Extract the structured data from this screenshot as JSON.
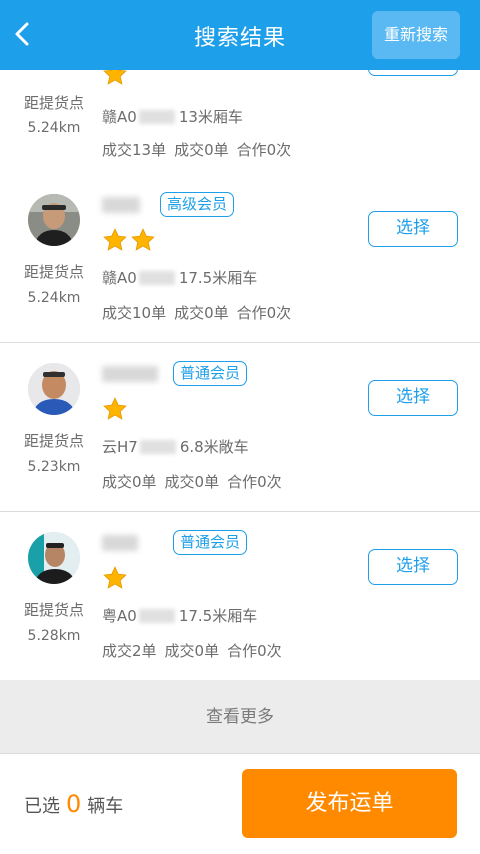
{
  "header": {
    "title": "搜索结果",
    "research_label": "重新搜索"
  },
  "colors": {
    "primary": "#1e9fe9",
    "accent": "#ff8a00",
    "star": "#ffb400"
  },
  "icons": {
    "back": "chevron-left-icon",
    "star": "star-icon"
  },
  "cards": [
    {
      "badge": "",
      "stars": 1,
      "distance_label": "距提货点",
      "distance": "5.24km",
      "vehicle_prefix": "赣A0",
      "vehicle_desc": "13米厢车",
      "stats": [
        "成交13单",
        "成交0单",
        "合作0次"
      ],
      "select_label": ""
    },
    {
      "badge": "高级会员",
      "stars": 2,
      "distance_label": "距提货点",
      "distance": "5.24km",
      "vehicle_prefix": "赣A0",
      "vehicle_desc": "17.5米厢车",
      "stats": [
        "成交10单",
        "成交0单",
        "合作0次"
      ],
      "select_label": "选择"
    },
    {
      "badge": "普通会员",
      "stars": 1,
      "distance_label": "距提货点",
      "distance": "5.23km",
      "vehicle_prefix": "云H7",
      "vehicle_desc": "6.8米敞车",
      "stats": [
        "成交0单",
        "成交0单",
        "合作0次"
      ],
      "select_label": "选择"
    },
    {
      "badge": "普通会员",
      "stars": 1,
      "distance_label": "距提货点",
      "distance": "5.28km",
      "vehicle_prefix": "粤A0",
      "vehicle_desc": "17.5米厢车",
      "stats": [
        "成交2单",
        "成交0单",
        "合作0次"
      ],
      "select_label": "选择"
    }
  ],
  "more_label": "查看更多",
  "footer": {
    "selected_prefix": "已选",
    "selected_count": "0",
    "selected_suffix": "辆车",
    "publish_label": "发布运单"
  }
}
